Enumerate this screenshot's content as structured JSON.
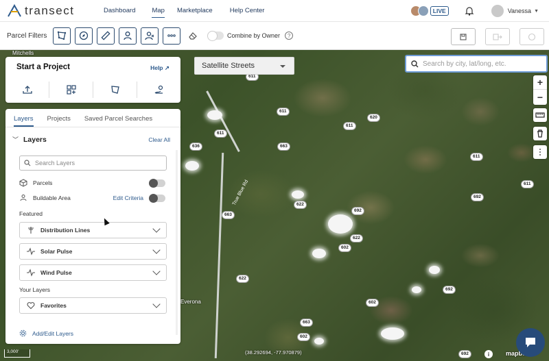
{
  "app": {
    "logo_text": "transect",
    "nav": [
      "Dashboard",
      "Map",
      "Marketplace",
      "Help Center"
    ],
    "active_nav": "Map",
    "live_label": "LIVE",
    "user_name": "Vanessa"
  },
  "filterbar": {
    "label": "Parcel Filters",
    "combine_label": "Combine by Owner",
    "help_glyph": "?"
  },
  "map": {
    "basemap": "Satellite Streets",
    "search_placeholder": "Search by city, lat/long, etc.",
    "zoom_in": "+",
    "zoom_out": "−",
    "coordinates": "(38.292694, -77.970879)",
    "scale": "3,000'",
    "attribution": "mapbox",
    "info_glyph": "i",
    "road_label": "True Blue Rd",
    "place_labels": [
      "Mitchells",
      "Everona"
    ],
    "route_shields": [
      "611",
      "611",
      "620",
      "611",
      "663",
      "611",
      "636",
      "611",
      "663",
      "622",
      "692",
      "622",
      "692",
      "622",
      "692",
      "602",
      "663",
      "602",
      "602",
      "611",
      "692"
    ]
  },
  "start_project": {
    "title": "Start a Project",
    "help": "Help"
  },
  "layers_panel": {
    "tabs": [
      "Layers",
      "Projects",
      "Saved Parcel Searches"
    ],
    "active_tab": "Layers",
    "section_title": "Layers",
    "clear_all": "Clear All",
    "search_placeholder": "Search Layers",
    "parcels_label": "Parcels",
    "buildable_label": "Buildable Area",
    "edit_criteria": "Edit Criteria",
    "featured_label": "Featured",
    "featured": [
      "Distribution Lines",
      "Solar Pulse",
      "Wind Pulse"
    ],
    "your_layers_label": "Your Layers",
    "favorites": "Favorites",
    "add_edit": "Add/Edit Layers"
  },
  "colors": {
    "brand_blue": "#2d5a8c",
    "chat_blue": "#274b7a",
    "search_focus": "#6d9bd6"
  }
}
